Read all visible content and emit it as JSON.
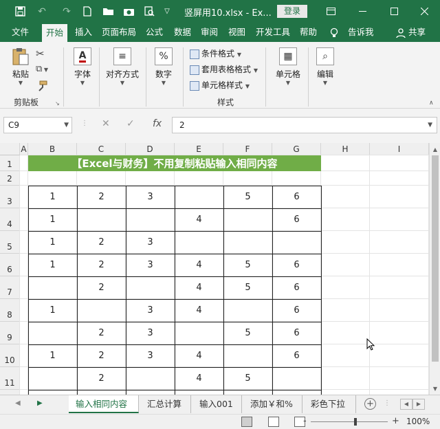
{
  "window": {
    "title": "竖屏用10.xlsx  -  Ex...",
    "login_label": "登录",
    "quick_access_icons": [
      "save-icon",
      "undo-icon",
      "redo-icon",
      "new-file-icon",
      "open-folder-icon",
      "camera-icon",
      "print-preview-icon",
      "customize-dropdown-icon"
    ]
  },
  "ribbon_tabs": [
    {
      "label": "文件",
      "active": false
    },
    {
      "label": "开始",
      "active": true
    },
    {
      "label": "插入",
      "active": false
    },
    {
      "label": "页面布局",
      "active": false
    },
    {
      "label": "公式",
      "active": false
    },
    {
      "label": "数据",
      "active": false
    },
    {
      "label": "审阅",
      "active": false
    },
    {
      "label": "视图",
      "active": false
    },
    {
      "label": "开发工具",
      "active": false
    },
    {
      "label": "帮助",
      "active": false
    }
  ],
  "tell_me": "告诉我",
  "share": "共享",
  "ribbon": {
    "paste": "粘贴",
    "clipboard_group": "剪贴板",
    "font": "字体",
    "alignment": "对齐方式",
    "number": "数字",
    "conditional_format": "条件格式",
    "table_format": "套用表格格式",
    "cell_style": "单元格样式",
    "styles_group": "样式",
    "cells": "单元格",
    "editing": "编辑"
  },
  "formula_bar": {
    "name_box": "C9",
    "value": "2",
    "fx": "fx"
  },
  "columns": [
    "A",
    "B",
    "C",
    "D",
    "E",
    "F",
    "G",
    "H",
    "I"
  ],
  "rows": [
    "1",
    "2",
    "3",
    "4",
    "5",
    "6",
    "7",
    "8",
    "9",
    "10",
    "11"
  ],
  "banner": "【Excel与财务】不用复制粘贴输入相同内容",
  "table": [
    [
      "1",
      "2",
      "3",
      "",
      "5",
      "6"
    ],
    [
      "1",
      "",
      "",
      "4",
      "",
      "6"
    ],
    [
      "1",
      "2",
      "3",
      "",
      "",
      ""
    ],
    [
      "1",
      "2",
      "3",
      "4",
      "5",
      "6"
    ],
    [
      "",
      "2",
      "",
      "4",
      "5",
      "6"
    ],
    [
      "1",
      "",
      "3",
      "4",
      "",
      "6"
    ],
    [
      "",
      "2",
      "3",
      "",
      "5",
      "6"
    ],
    [
      "1",
      "2",
      "3",
      "4",
      "",
      "6"
    ],
    [
      "",
      "2",
      "",
      "4",
      "5",
      ""
    ]
  ],
  "sheet_tabs": [
    {
      "label": "输入相同内容",
      "active": true
    },
    {
      "label": "汇总计算",
      "active": false
    },
    {
      "label": "输入001",
      "active": false
    },
    {
      "label": "添加￥和%",
      "active": false
    },
    {
      "label": "彩色下拉",
      "active": false
    }
  ],
  "status": {
    "zoom": "100%",
    "zoom_percent": 100
  }
}
